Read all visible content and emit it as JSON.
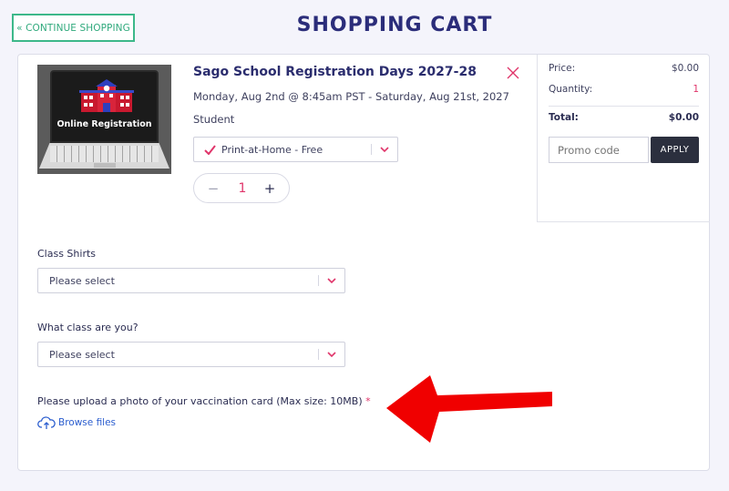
{
  "header": {
    "continue_label": "« CONTINUE SHOPPING",
    "title": "SHOPPING CART"
  },
  "item": {
    "thumbnail_caption": "Online Registration",
    "title": "Sago School Registration Days 2027-28",
    "date": "Monday, Aug 2nd @ 8:45am PST - Saturday, Aug 21st, 2027",
    "ticket_type": "Student",
    "delivery_option": "Print-at-Home - Free",
    "quantity": "1",
    "minus": "−",
    "plus": "+"
  },
  "summary": {
    "price_label": "Price:",
    "price_value": "$0.00",
    "quantity_label": "Quantity:",
    "quantity_value": "1",
    "total_label": "Total:",
    "total_value": "$0.00",
    "promo_placeholder": "Promo code",
    "apply_label": "APPLY"
  },
  "form": {
    "shirts_label": "Class Shirts",
    "shirts_value": "Please select",
    "class_label": "What class are you?",
    "class_value": "Please select",
    "upload_label": "Please upload a photo of your vaccination card (Max size: 10MB)",
    "required_mark": "*",
    "browse_label": "Browse files"
  },
  "colors": {
    "accent": "#e0356a",
    "brand_green": "#3db88a",
    "navy": "#2b2d7a",
    "arrow": "#f00000"
  },
  "icons": [
    "close-icon",
    "check-icon",
    "chevron-down-icon",
    "cloud-upload-icon",
    "arrow-annotation"
  ]
}
